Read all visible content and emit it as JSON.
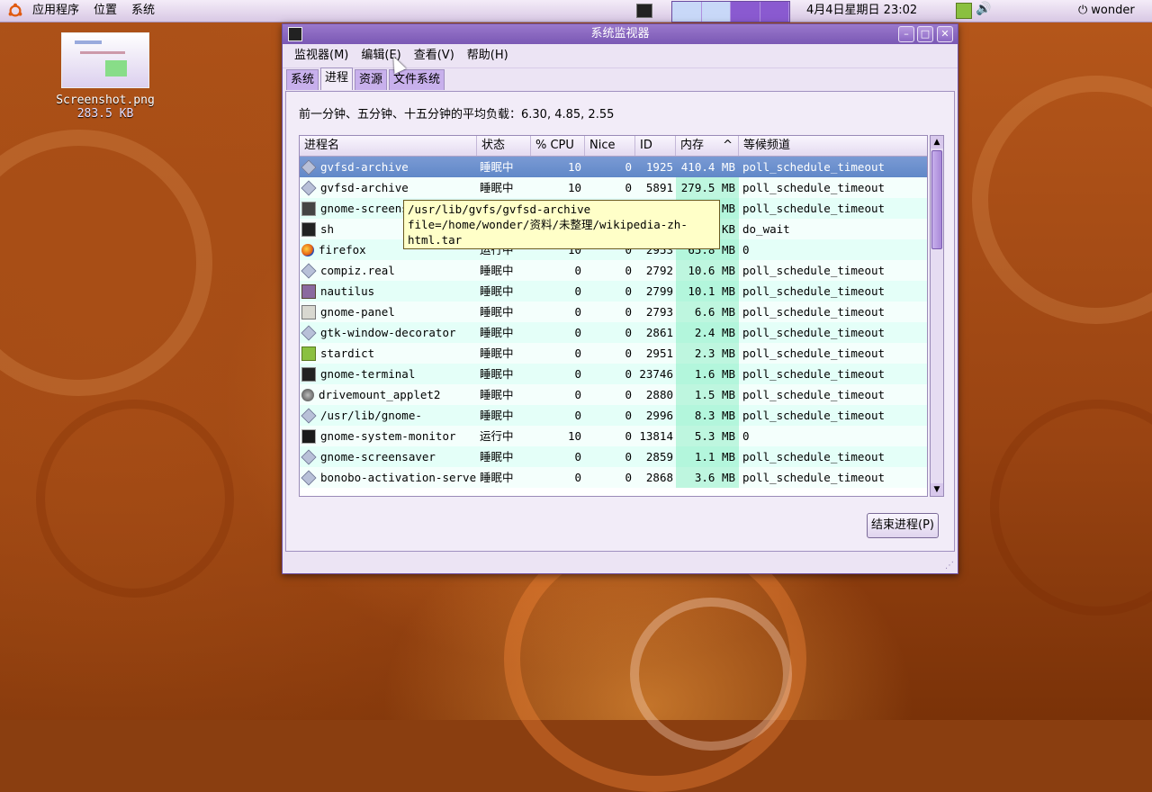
{
  "top_panel": {
    "menus": [
      "应用程序",
      "位置",
      "系统"
    ],
    "clock": "4月4日星期日 23:02",
    "user": "wonder"
  },
  "desktop_icon": {
    "name": "Screenshot.png",
    "size": "283.5 KB"
  },
  "window": {
    "title": "系统监视器",
    "menus": [
      "监视器(M)",
      "编辑(E)",
      "查看(V)",
      "帮助(H)"
    ],
    "tabs": [
      {
        "label": "系统",
        "active": false
      },
      {
        "label": "进程",
        "active": true
      },
      {
        "label": "资源",
        "active": false
      },
      {
        "label": "文件系统",
        "active": false
      }
    ],
    "load_average": "前一分钟、五分钟、十五分钟的平均负载：6.30, 4.85, 2.55",
    "columns": [
      "进程名",
      "状态",
      "% CPU",
      "Nice",
      "ID",
      "内存",
      "等候频道"
    ],
    "sort_indicator": "^",
    "processes": [
      {
        "icon": "gear-icon",
        "name": "gvfsd-archive",
        "state": "睡眠中",
        "cpu": "10",
        "nice": "0",
        "id": "1925",
        "mem": "410.4 MB",
        "wait": "poll_schedule_timeout",
        "selected": true
      },
      {
        "icon": "gear-icon",
        "name": "gvfsd-archive",
        "state": "睡眠中",
        "cpu": "10",
        "nice": "0",
        "id": "5891",
        "mem": "279.5 MB",
        "wait": "poll_schedule_timeout"
      },
      {
        "icon": "camera-icon",
        "name": "gnome-screenshot",
        "state": "",
        "cpu": "",
        "nice": "",
        "id": "",
        "mem": "1 MB",
        "wait": "poll_schedule_timeout"
      },
      {
        "icon": "terminal-icon",
        "name": "sh",
        "state": "",
        "cpu": "",
        "nice": "",
        "id": "",
        "mem": "0 KB",
        "wait": "do_wait"
      },
      {
        "icon": "firefox-icon",
        "name": "firefox",
        "state": "运行中",
        "cpu": "10",
        "nice": "0",
        "id": "2953",
        "mem": "65.8 MB",
        "wait": "0"
      },
      {
        "icon": "gear-icon",
        "name": "compiz.real",
        "state": "睡眠中",
        "cpu": "0",
        "nice": "0",
        "id": "2792",
        "mem": "10.6 MB",
        "wait": "poll_schedule_timeout"
      },
      {
        "icon": "nautilus-icon",
        "name": "nautilus",
        "state": "睡眠中",
        "cpu": "0",
        "nice": "0",
        "id": "2799",
        "mem": "10.1 MB",
        "wait": "poll_schedule_timeout"
      },
      {
        "icon": "panel-icon",
        "name": "gnome-panel",
        "state": "睡眠中",
        "cpu": "0",
        "nice": "0",
        "id": "2793",
        "mem": "6.6 MB",
        "wait": "poll_schedule_timeout"
      },
      {
        "icon": "gear-icon",
        "name": "gtk-window-decorator",
        "state": "睡眠中",
        "cpu": "0",
        "nice": "0",
        "id": "2861",
        "mem": "2.4 MB",
        "wait": "poll_schedule_timeout"
      },
      {
        "icon": "book-icon",
        "name": "stardict",
        "state": "睡眠中",
        "cpu": "0",
        "nice": "0",
        "id": "2951",
        "mem": "2.3 MB",
        "wait": "poll_schedule_timeout"
      },
      {
        "icon": "terminal-icon",
        "name": "gnome-terminal",
        "state": "睡眠中",
        "cpu": "0",
        "nice": "0",
        "id": "23746",
        "mem": "1.6 MB",
        "wait": "poll_schedule_timeout"
      },
      {
        "icon": "drive-icon",
        "name": "drivemount_applet2",
        "state": "睡眠中",
        "cpu": "0",
        "nice": "0",
        "id": "2880",
        "mem": "1.5 MB",
        "wait": "poll_schedule_timeout"
      },
      {
        "icon": "gear-icon",
        "name": "/usr/lib/gnome-",
        "state": "睡眠中",
        "cpu": "0",
        "nice": "0",
        "id": "2996",
        "mem": "8.3 MB",
        "wait": "poll_schedule_timeout"
      },
      {
        "icon": "monitor-icon",
        "name": "gnome-system-monitor",
        "state": "运行中",
        "cpu": "10",
        "nice": "0",
        "id": "13814",
        "mem": "5.3 MB",
        "wait": "0"
      },
      {
        "icon": "gear-icon",
        "name": "gnome-screensaver",
        "state": "睡眠中",
        "cpu": "0",
        "nice": "0",
        "id": "2859",
        "mem": "1.1 MB",
        "wait": "poll_schedule_timeout"
      },
      {
        "icon": "gear-icon",
        "name": "bonobo-activation-server",
        "state": "睡眠中",
        "cpu": "0",
        "nice": "0",
        "id": "2868",
        "mem": "3.6 MB",
        "wait": "poll_schedule_timeout"
      }
    ],
    "end_process_button": "结束进程(P)",
    "tooltip": "/usr/lib/gvfs/gvfsd-archive file=/home/wonder/资料/未整理/wikipedia-zh-html.tar"
  }
}
